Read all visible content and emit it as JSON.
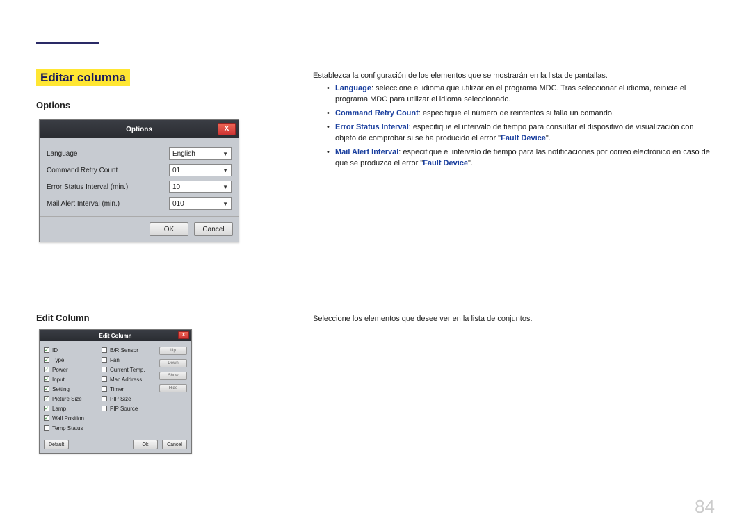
{
  "page": {
    "section_title": "Editar columna",
    "page_number": "84"
  },
  "left": {
    "options_heading": "Options",
    "editcol_heading": "Edit Column"
  },
  "intro": "Establezca la configuración de los elementos que se mostrarán en la lista de pantallas.",
  "bullets": {
    "b1_term": "Language",
    "b1_rest": ": seleccione el idioma que utilizar en el programa MDC. Tras seleccionar el idioma, reinicie el programa MDC para utilizar el idioma seleccionado.",
    "b2_term": "Command Retry Count",
    "b2_rest": ": especifique el número de reintentos si falla un comando.",
    "b3_term": "Error Status Interval",
    "b3_rest_a": ": especifique el intervalo de tiempo para consultar el dispositivo de visualización con objeto de comprobar si se ha producido el error \"",
    "b3_fault": "Fault Device",
    "b3_rest_b": "\".",
    "b4_term": "Mail Alert Interval",
    "b4_rest_a": ": especifique el intervalo de tiempo para las notificaciones por correo electrónico en caso de que se produzca el error \"",
    "b4_fault": "Fault Device",
    "b4_rest_b": "\"."
  },
  "editcol_text": "Seleccione los elementos que desee ver en la lista de conjuntos.",
  "options_dialog": {
    "title": "Options",
    "close": "X",
    "rows": {
      "language_label": "Language",
      "language_value": "English",
      "retry_label": "Command Retry Count",
      "retry_value": "01",
      "error_label": "Error Status Interval (min.)",
      "error_value": "10",
      "mail_label": "Mail Alert Interval (min.)",
      "mail_value": "010"
    },
    "ok": "OK",
    "cancel": "Cancel"
  },
  "editcol_dialog": {
    "title": "Edit Column",
    "close": "X",
    "col1": [
      {
        "label": "ID",
        "checked": true
      },
      {
        "label": "Type",
        "checked": true
      },
      {
        "label": "Power",
        "checked": true
      },
      {
        "label": "Input",
        "checked": true
      },
      {
        "label": "Setting",
        "checked": true
      },
      {
        "label": "Picture Size",
        "checked": true
      },
      {
        "label": "Lamp",
        "checked": true
      },
      {
        "label": "Wall Position",
        "checked": true
      },
      {
        "label": "Temp Status",
        "checked": false
      }
    ],
    "col2": [
      {
        "label": "B/R Sensor",
        "checked": false
      },
      {
        "label": "Fan",
        "checked": false
      },
      {
        "label": "Current Temp.",
        "checked": false
      },
      {
        "label": "Mac Address",
        "checked": false
      },
      {
        "label": "Timer",
        "checked": false
      },
      {
        "label": "PIP Size",
        "checked": false
      },
      {
        "label": "PIP Source",
        "checked": false
      }
    ],
    "side": {
      "up": "Up",
      "down": "Down",
      "show": "Show",
      "hide": "Hide"
    },
    "default_btn": "Default",
    "ok": "Ok",
    "cancel": "Cancel"
  }
}
